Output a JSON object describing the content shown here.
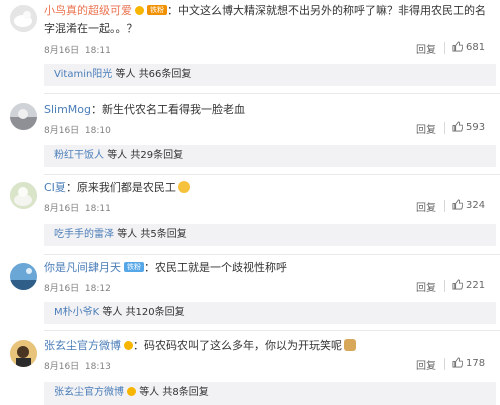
{
  "comments": [
    {
      "username": "小鸟真的超级可爱",
      "badge": "铁粉",
      "content": "：中文这么博大精深就想不出另外的称呼了嘛？非得用农民工的名字混淆在一起。。？",
      "date": "8月16日",
      "time": "18:11",
      "reply_label": "回复",
      "likes": "681",
      "replies_user": "Vitamin阳光",
      "replies_mid": "等人",
      "replies_count": "共66条回复",
      "avatar_icon": "avatar-icon"
    },
    {
      "username": "SlimMog",
      "content": "：新生代农名工看得我一脸老血",
      "date": "8月16日",
      "time": "18:10",
      "reply_label": "回复",
      "likes": "593",
      "replies_user": "粉红干饭人",
      "replies_mid": "等人",
      "replies_count": "共29条回复"
    },
    {
      "username": "CI夏",
      "content": "：原来我们都是农民工",
      "date": "8月16日",
      "time": "18:11",
      "reply_label": "回复",
      "likes": "324",
      "replies_user": "吃手手的雷泽",
      "replies_mid": "等人",
      "replies_count": "共5条回复"
    },
    {
      "username": "你是凡间肆月天",
      "badge": "铁粉",
      "content": "：农民工就是一个歧视性称呼",
      "date": "8月16日",
      "time": "18:12",
      "reply_label": "回复",
      "likes": "221",
      "replies_user": "M朴小爷K",
      "replies_mid": "等人",
      "replies_count": "共120条回复"
    },
    {
      "username": "张玄尘官方微博",
      "content": "：码农码农叫了这么多年，你以为开玩笑呢",
      "date": "8月16日",
      "time": "18:13",
      "reply_label": "回复",
      "likes": "178",
      "replies_user": "张玄尘官方微博",
      "replies_mid": "等人",
      "replies_count": "共8条回复"
    }
  ],
  "colors": {
    "username": "#eb7350",
    "link": "#4a7db8",
    "reply_bg": "#f2f2f5",
    "meta": "#808080"
  }
}
